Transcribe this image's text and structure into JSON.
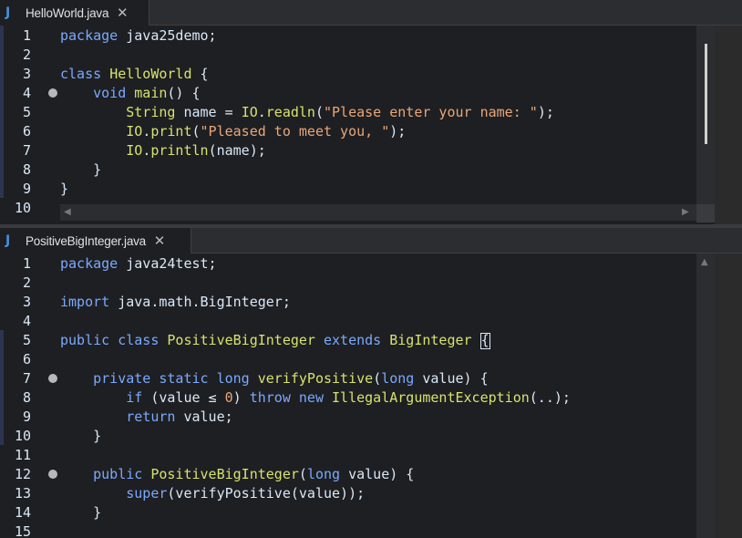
{
  "editors": [
    {
      "tab": {
        "icon": "J",
        "label": "HelloWorld.java",
        "close": "✕"
      },
      "lines": [
        {
          "n": "1",
          "tokens": [
            [
              "kw",
              "package "
            ],
            [
              "plain",
              "java25demo;"
            ]
          ]
        },
        {
          "n": "2",
          "tokens": []
        },
        {
          "n": "3",
          "tokens": [
            [
              "kw",
              "class "
            ],
            [
              "cls",
              "HelloWorld "
            ],
            [
              "plain",
              "{"
            ]
          ]
        },
        {
          "n": "4",
          "fold": true,
          "tokens": [
            [
              "plain",
              "    "
            ],
            [
              "kw",
              "void "
            ],
            [
              "meth",
              "main"
            ],
            [
              "plain",
              "() {"
            ]
          ]
        },
        {
          "n": "5",
          "tokens": [
            [
              "plain",
              "        "
            ],
            [
              "cls",
              "String "
            ],
            [
              "plain",
              "name = "
            ],
            [
              "cls",
              "IO"
            ],
            [
              "plain",
              "."
            ],
            [
              "meth",
              "readln"
            ],
            [
              "plain",
              "("
            ],
            [
              "str",
              "\"Please enter your name: \""
            ],
            [
              "plain",
              ");"
            ]
          ]
        },
        {
          "n": "6",
          "tokens": [
            [
              "plain",
              "        "
            ],
            [
              "cls",
              "IO"
            ],
            [
              "plain",
              "."
            ],
            [
              "meth",
              "print"
            ],
            [
              "plain",
              "("
            ],
            [
              "str",
              "\"Pleased to meet you, \""
            ],
            [
              "plain",
              ");"
            ]
          ]
        },
        {
          "n": "7",
          "tokens": [
            [
              "plain",
              "        "
            ],
            [
              "cls",
              "IO"
            ],
            [
              "plain",
              "."
            ],
            [
              "meth",
              "println"
            ],
            [
              "plain",
              "(name);"
            ]
          ]
        },
        {
          "n": "8",
          "tokens": [
            [
              "plain",
              "    }"
            ]
          ]
        },
        {
          "n": "9",
          "tokens": [
            [
              "plain",
              "}"
            ]
          ]
        },
        {
          "n": "10",
          "tokens": []
        }
      ]
    },
    {
      "tab": {
        "icon": "J",
        "label": "PositiveBigInteger.java",
        "close": "✕"
      },
      "lines": [
        {
          "n": "1",
          "tokens": [
            [
              "kw",
              "package "
            ],
            [
              "plain",
              "java24test;"
            ]
          ]
        },
        {
          "n": "2",
          "tokens": []
        },
        {
          "n": "3",
          "tokens": [
            [
              "kw",
              "import "
            ],
            [
              "plain",
              "java.math.BigInteger;"
            ]
          ]
        },
        {
          "n": "4",
          "tokens": []
        },
        {
          "n": "5",
          "tokens": [
            [
              "kw",
              "public class "
            ],
            [
              "cls",
              "PositiveBigInteger "
            ],
            [
              "kw",
              "extends "
            ],
            [
              "cls",
              "BigInteger "
            ],
            [
              "caret",
              "{"
            ]
          ]
        },
        {
          "n": "6",
          "tokens": []
        },
        {
          "n": "7",
          "fold": true,
          "tokens": [
            [
              "plain",
              "    "
            ],
            [
              "kw",
              "private static long "
            ],
            [
              "meth",
              "verifyPositive"
            ],
            [
              "plain",
              "("
            ],
            [
              "kw",
              "long "
            ],
            [
              "plain",
              "value) {"
            ]
          ]
        },
        {
          "n": "8",
          "tokens": [
            [
              "plain",
              "        "
            ],
            [
              "kw",
              "if "
            ],
            [
              "plain",
              "(value ≤ "
            ],
            [
              "num",
              "0"
            ],
            [
              "plain",
              ") "
            ],
            [
              "kw",
              "throw new "
            ],
            [
              "cls",
              "IllegalArgumentException"
            ],
            [
              "plain",
              "(..);"
            ]
          ]
        },
        {
          "n": "9",
          "tokens": [
            [
              "plain",
              "        "
            ],
            [
              "kw",
              "return "
            ],
            [
              "plain",
              "value;"
            ]
          ]
        },
        {
          "n": "10",
          "tokens": [
            [
              "plain",
              "    }"
            ]
          ]
        },
        {
          "n": "11",
          "tokens": []
        },
        {
          "n": "12",
          "fold": true,
          "tokens": [
            [
              "plain",
              "    "
            ],
            [
              "kw",
              "public "
            ],
            [
              "meth",
              "PositiveBigInteger"
            ],
            [
              "plain",
              "("
            ],
            [
              "kw",
              "long "
            ],
            [
              "plain",
              "value) {"
            ]
          ]
        },
        {
          "n": "13",
          "tokens": [
            [
              "plain",
              "        "
            ],
            [
              "kw",
              "super"
            ],
            [
              "plain",
              "(verifyPositive(value));"
            ]
          ]
        },
        {
          "n": "14",
          "tokens": [
            [
              "plain",
              "    }"
            ]
          ]
        },
        {
          "n": "15",
          "tokens": []
        }
      ]
    }
  ],
  "scroll": {
    "left_arrow": "◀",
    "right_arrow": "▶",
    "up_arrow": "▲"
  },
  "colors": {
    "keyword": "#7aa9ff",
    "class": "#d7e36c",
    "string": "#e8a77a",
    "text": "#d9e8f7",
    "background": "#1e1f22"
  }
}
